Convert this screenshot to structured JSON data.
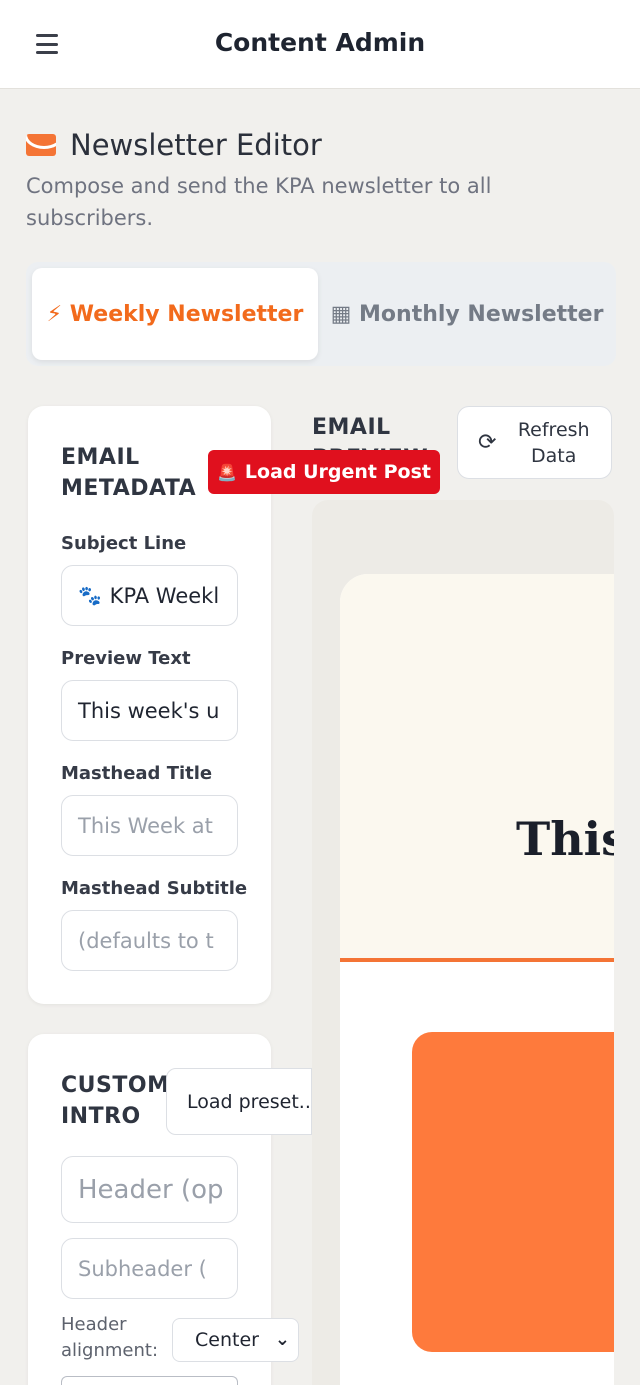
{
  "header": {
    "app_title": "Content Admin",
    "menu_icon": "hamburger-menu-icon"
  },
  "page": {
    "title": "Newsletter Editor",
    "description": "Compose and send the KPA newsletter to all subscribers.",
    "title_icon": "envelope-icon"
  },
  "tabs": [
    {
      "label": "Weekly Newsletter",
      "icon": "lightning-bolt-icon",
      "active": true
    },
    {
      "label": "Monthly Newsletter",
      "icon": "calendar-icon",
      "active": false
    }
  ],
  "metadata": {
    "section_title": "EMAIL METADATA",
    "subject_label": "Subject Line",
    "subject_value": "KPA Weekl",
    "preview_label": "Preview Text",
    "preview_value": "This week's u",
    "masthead_title_label": "Masthead Title",
    "masthead_title_placeholder": "This Week at",
    "masthead_subtitle_label": "Masthead Subtitle",
    "masthead_subtitle_placeholder": "(defaults to t"
  },
  "preview": {
    "label": "EMAIL PREVIEW",
    "refresh_label": "Refresh Data",
    "urgent_label": "Load Urgent Post",
    "masthead_title": "This"
  },
  "intro": {
    "section_title": "CUSTOM INTRO",
    "preset_label": "Load preset...",
    "header_placeholder": "Header (op",
    "subheader_placeholder": "Subheader (",
    "alignment_label": "Header alignment:",
    "alignment_value": "Center"
  },
  "colors": {
    "accent": "#f26a1c",
    "urgent": "#e0101e",
    "hero": "#fe7a3c"
  }
}
